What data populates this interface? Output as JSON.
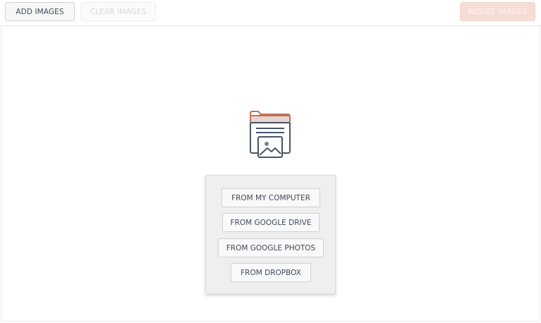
{
  "toolbar": {
    "add_label": "ADD IMAGES",
    "clear_label": "CLEAR IMAGES",
    "resize_label": "RESIZE IMAGES"
  },
  "upload_menu": {
    "items": [
      {
        "label": "FROM MY COMPUTER"
      },
      {
        "label": "FROM GOOGLE DRIVE"
      },
      {
        "label": "FROM GOOGLE PHOTOS"
      },
      {
        "label": "FROM DROPBOX"
      }
    ]
  },
  "colors": {
    "accent": "#c0735a",
    "icon_dark": "#4a5568",
    "resize_disabled_bg": "#f5ddd6"
  },
  "icons": {
    "dropzone": "folder-image-icon"
  }
}
